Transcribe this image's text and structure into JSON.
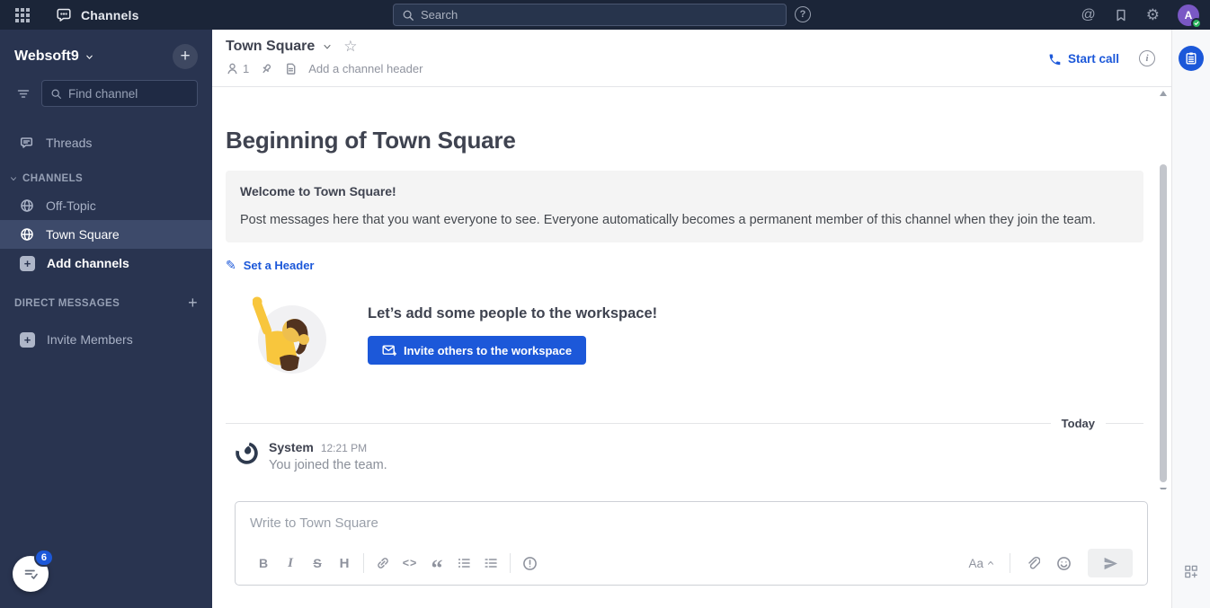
{
  "colors": {
    "accent_blue": "#1c58d9",
    "topbar_bg": "#1b2538",
    "sidebar_bg": "#293450",
    "sidebar_active_bg": "#3d4a6a",
    "rail_bg": "#f7f8fa",
    "text_dark": "#3f4350",
    "text_gray": "#8f939e",
    "avatar_purple": "#7a58c5",
    "online_green": "#2bb55e"
  },
  "topbar": {
    "app_label": "Channels",
    "search_placeholder": "Search",
    "avatar_initial": "A"
  },
  "sidebar": {
    "team_name": "Websoft9",
    "find_channel_placeholder": "Find channel",
    "threads_label": "Threads",
    "channels_header": "CHANNELS",
    "channels": [
      {
        "label": "Off-Topic"
      },
      {
        "label": "Town Square"
      }
    ],
    "add_channels_label": "Add channels",
    "direct_messages_header": "DIRECT MESSAGES",
    "invite_members_label": "Invite Members",
    "tasks_badge_count": "6"
  },
  "channel_header": {
    "title": "Town Square",
    "member_count": "1",
    "add_header_placeholder": "Add a channel header",
    "start_call_label": "Start call"
  },
  "content": {
    "intro_heading": "Beginning of Town Square",
    "welcome_title": "Welcome to Town Square!",
    "welcome_body": "Post messages here that you want everyone to see. Everyone automatically becomes a permanent member of this channel when they join the team.",
    "set_header_label": "Set a Header",
    "invite_heading": "Let’s add some people to the workspace!",
    "invite_button_label": "Invite others to the workspace",
    "date_divider_label": "Today",
    "system_message": {
      "author": "System",
      "timestamp": "12:21 PM",
      "text": "You joined the team."
    }
  },
  "composer": {
    "placeholder": "Write to Town Square",
    "bold_label": "B",
    "italic_label": "I",
    "strike_label": "S",
    "heading_label": "H",
    "code_label": "<>",
    "format_toggle_label": "Aa"
  },
  "icons": {
    "star": "☆",
    "gear": "⚙",
    "at": "@",
    "help": "?",
    "info": "i",
    "pencil": "✎",
    "plus": "+",
    "blockquote": "“"
  }
}
